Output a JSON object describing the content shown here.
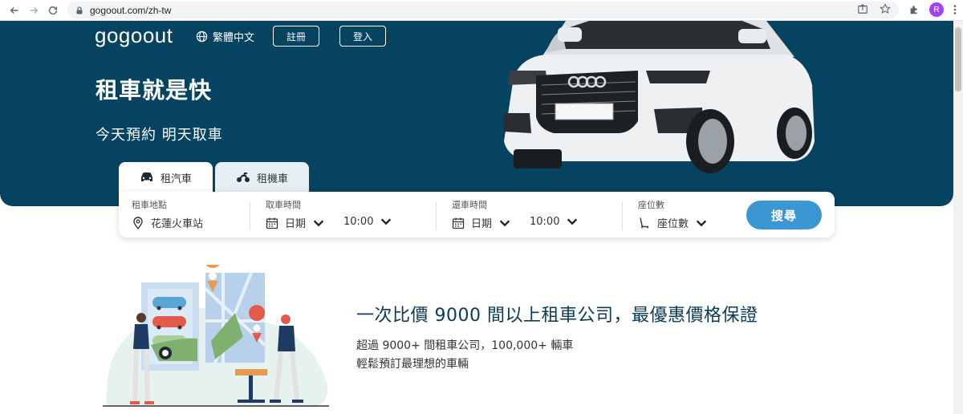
{
  "browser": {
    "url": "gogoout.com/zh-tw",
    "avatar_letter": "R"
  },
  "header": {
    "logo": "gogoout",
    "language": "繁體中文",
    "register": "註冊",
    "login": "登入"
  },
  "hero": {
    "title": "租車就是快",
    "subtitle": "今天預約 明天取車",
    "tabs": [
      {
        "label": "租汽車",
        "active": true
      },
      {
        "label": "租機車",
        "active": false
      }
    ]
  },
  "search": {
    "location_label": "租車地點",
    "location_value": "花蓮火車站",
    "pickup_label": "取車時間",
    "pickup_date": "日期",
    "pickup_time": "10:00",
    "return_label": "還車時間",
    "return_date": "日期",
    "return_time": "10:00",
    "seats_label": "座位數",
    "seats_value": "座位數",
    "button": "搜尋"
  },
  "promo": {
    "title": "一次比價 9000 間以上租車公司，最優惠價格保證",
    "line1": "超過 9000+ 間租車公司，100,000+ 輛車",
    "line2": "輕鬆預訂最理想的車輛"
  },
  "colors": {
    "hero_bg": "#054361",
    "accent": "#3b97d3",
    "promo_title": "#0b3a55"
  }
}
